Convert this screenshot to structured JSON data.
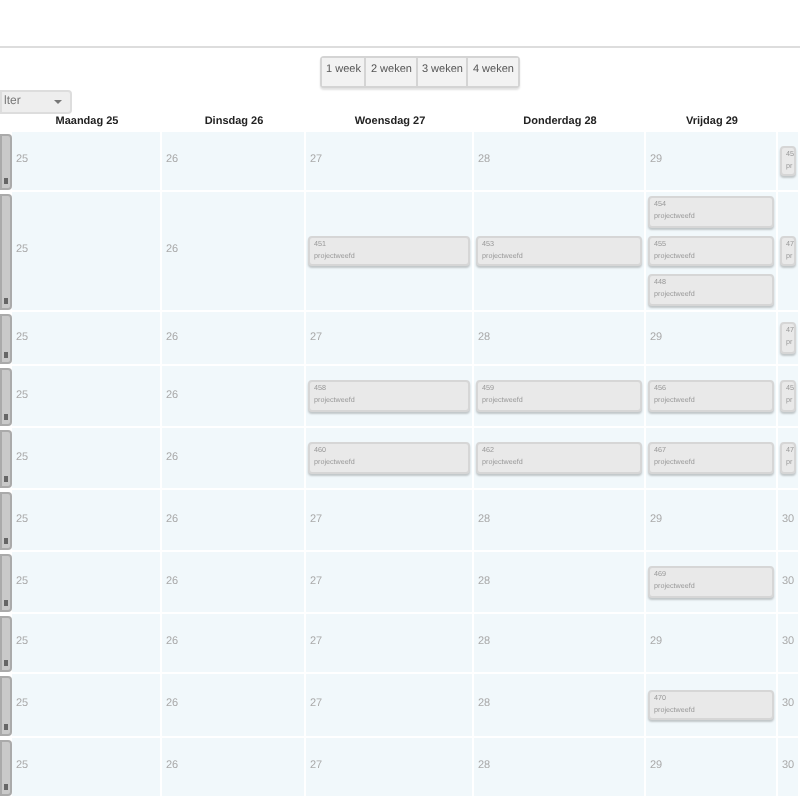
{
  "view_buttons": [
    {
      "label": "1 week",
      "selected": false
    },
    {
      "label": "2 weken",
      "selected": false
    },
    {
      "label": "3 weken",
      "selected": false
    },
    {
      "label": "4 weken",
      "selected": false
    }
  ],
  "filter": {
    "label": "lter"
  },
  "columns": [
    "Maandag 25",
    "Dinsdag 26",
    "Woensdag 27",
    "Donderdag 28",
    "Vrijdag 29"
  ],
  "weeks": [
    {
      "days": [
        {
          "date": "25"
        },
        {
          "date": "26"
        },
        {
          "date": "27"
        },
        {
          "date": "28"
        },
        {
          "date": "29"
        },
        {
          "events": [
            {
              "number": "45",
              "label": "pr"
            }
          ]
        }
      ]
    },
    {
      "days": [
        {
          "date": "25"
        },
        {
          "date": "26"
        },
        {
          "events": [
            {
              "number": "451",
              "label": "projectweefd"
            }
          ]
        },
        {
          "events": [
            {
              "number": "453",
              "label": "projectweefd"
            }
          ]
        },
        {
          "events": [
            {
              "number": "454",
              "label": "projectweefd"
            },
            {
              "number": "455",
              "label": "projectweefd"
            },
            {
              "number": "448",
              "label": "projectweefd"
            }
          ]
        },
        {
          "events": [
            {
              "number": "47",
              "label": "pr"
            }
          ]
        }
      ]
    },
    {
      "days": [
        {
          "date": "25"
        },
        {
          "date": "26"
        },
        {
          "date": "27"
        },
        {
          "date": "28"
        },
        {
          "date": "29"
        },
        {
          "events": [
            {
              "number": "47",
              "label": "pr"
            }
          ]
        }
      ]
    },
    {
      "days": [
        {
          "date": "25"
        },
        {
          "date": "26"
        },
        {
          "events": [
            {
              "number": "458",
              "label": "projectweefd"
            }
          ]
        },
        {
          "events": [
            {
              "number": "459",
              "label": "projectweefd"
            }
          ]
        },
        {
          "events": [
            {
              "number": "456",
              "label": "projectweefd"
            }
          ]
        },
        {
          "events": [
            {
              "number": "45",
              "label": "pr"
            }
          ]
        }
      ]
    },
    {
      "days": [
        {
          "date": "25"
        },
        {
          "date": "26"
        },
        {
          "events": [
            {
              "number": "460",
              "label": "projectweefd"
            }
          ]
        },
        {
          "events": [
            {
              "number": "462",
              "label": "projectweefd"
            }
          ]
        },
        {
          "events": [
            {
              "number": "467",
              "label": "projectweefd"
            }
          ]
        },
        {
          "events": [
            {
              "number": "47",
              "label": "pr"
            }
          ]
        }
      ]
    },
    {
      "days": [
        {
          "date": "25"
        },
        {
          "date": "26"
        },
        {
          "date": "27"
        },
        {
          "date": "28"
        },
        {
          "date": "29"
        },
        {
          "date": "30"
        }
      ]
    },
    {
      "days": [
        {
          "date": "25"
        },
        {
          "date": "26"
        },
        {
          "date": "27"
        },
        {
          "date": "28"
        },
        {
          "events": [
            {
              "number": "469",
              "label": "projectweefd"
            }
          ]
        },
        {
          "date": "30"
        }
      ]
    },
    {
      "days": [
        {
          "date": "25"
        },
        {
          "date": "26"
        },
        {
          "date": "27"
        },
        {
          "date": "28"
        },
        {
          "date": "29"
        },
        {
          "date": "30"
        }
      ]
    },
    {
      "days": [
        {
          "date": "25"
        },
        {
          "date": "26"
        },
        {
          "date": "27"
        },
        {
          "date": "28"
        },
        {
          "events": [
            {
              "number": "470",
              "label": "projectweefd"
            }
          ]
        },
        {
          "date": "30"
        }
      ]
    },
    {
      "days": [
        {
          "date": "25"
        },
        {
          "date": "26"
        },
        {
          "date": "27"
        },
        {
          "date": "28"
        },
        {
          "date": "29"
        },
        {
          "date": "30"
        }
      ]
    }
  ]
}
